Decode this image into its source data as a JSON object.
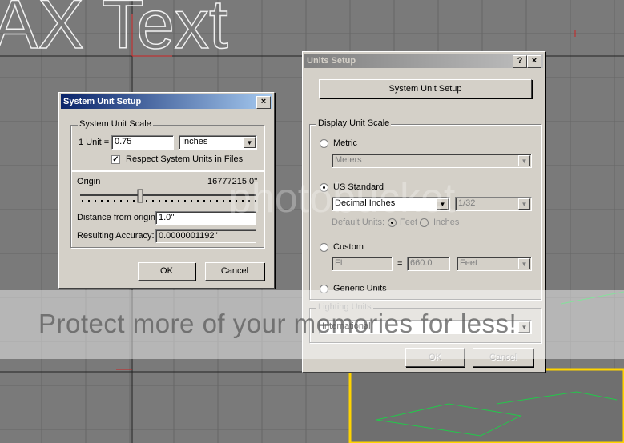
{
  "viewport": {
    "bg_text": "AX Text",
    "grid_color": "#5a5a5a",
    "bg_color": "#7a7a7a"
  },
  "system_unit_dialog": {
    "title": "System Unit Setup",
    "close_glyph": "×",
    "group_label": "System Unit Scale",
    "unit_label": "1 Unit =",
    "unit_value": "0.75",
    "unit_type": "Inches",
    "respect_units_label": "Respect System Units in Files",
    "respect_units_checked": true,
    "origin_label": "Origin",
    "origin_value": "16777215.0''",
    "distance_label": "Distance from origin:",
    "distance_value": "1.0''",
    "accuracy_label": "Resulting Accuracy:",
    "accuracy_value": "0.0000001192''",
    "ok_label": "OK",
    "cancel_label": "Cancel"
  },
  "units_dialog": {
    "title": "Units Setup",
    "help_glyph": "?",
    "close_glyph": "×",
    "system_unit_button": "System Unit Setup",
    "display_group_label": "Display Unit Scale",
    "metric_label": "Metric",
    "metric_value": "Meters",
    "us_label": "US Standard",
    "us_value": "Decimal Inches",
    "us_fraction": "1/32",
    "default_units_label": "Default Units:",
    "feet_label": "Feet",
    "inches_label": "Inches",
    "custom_label": "Custom",
    "custom_name": "FL",
    "custom_equals": "=",
    "custom_value": "660.0",
    "custom_unit": "Feet",
    "generic_label": "Generic Units",
    "lighting_group_label": "Lighting Units",
    "lighting_value": "International",
    "ok_label": "OK",
    "cancel_label": "Cancel"
  },
  "watermark": {
    "text": "Protect more of your memories for less!",
    "logo": "photobucket"
  }
}
